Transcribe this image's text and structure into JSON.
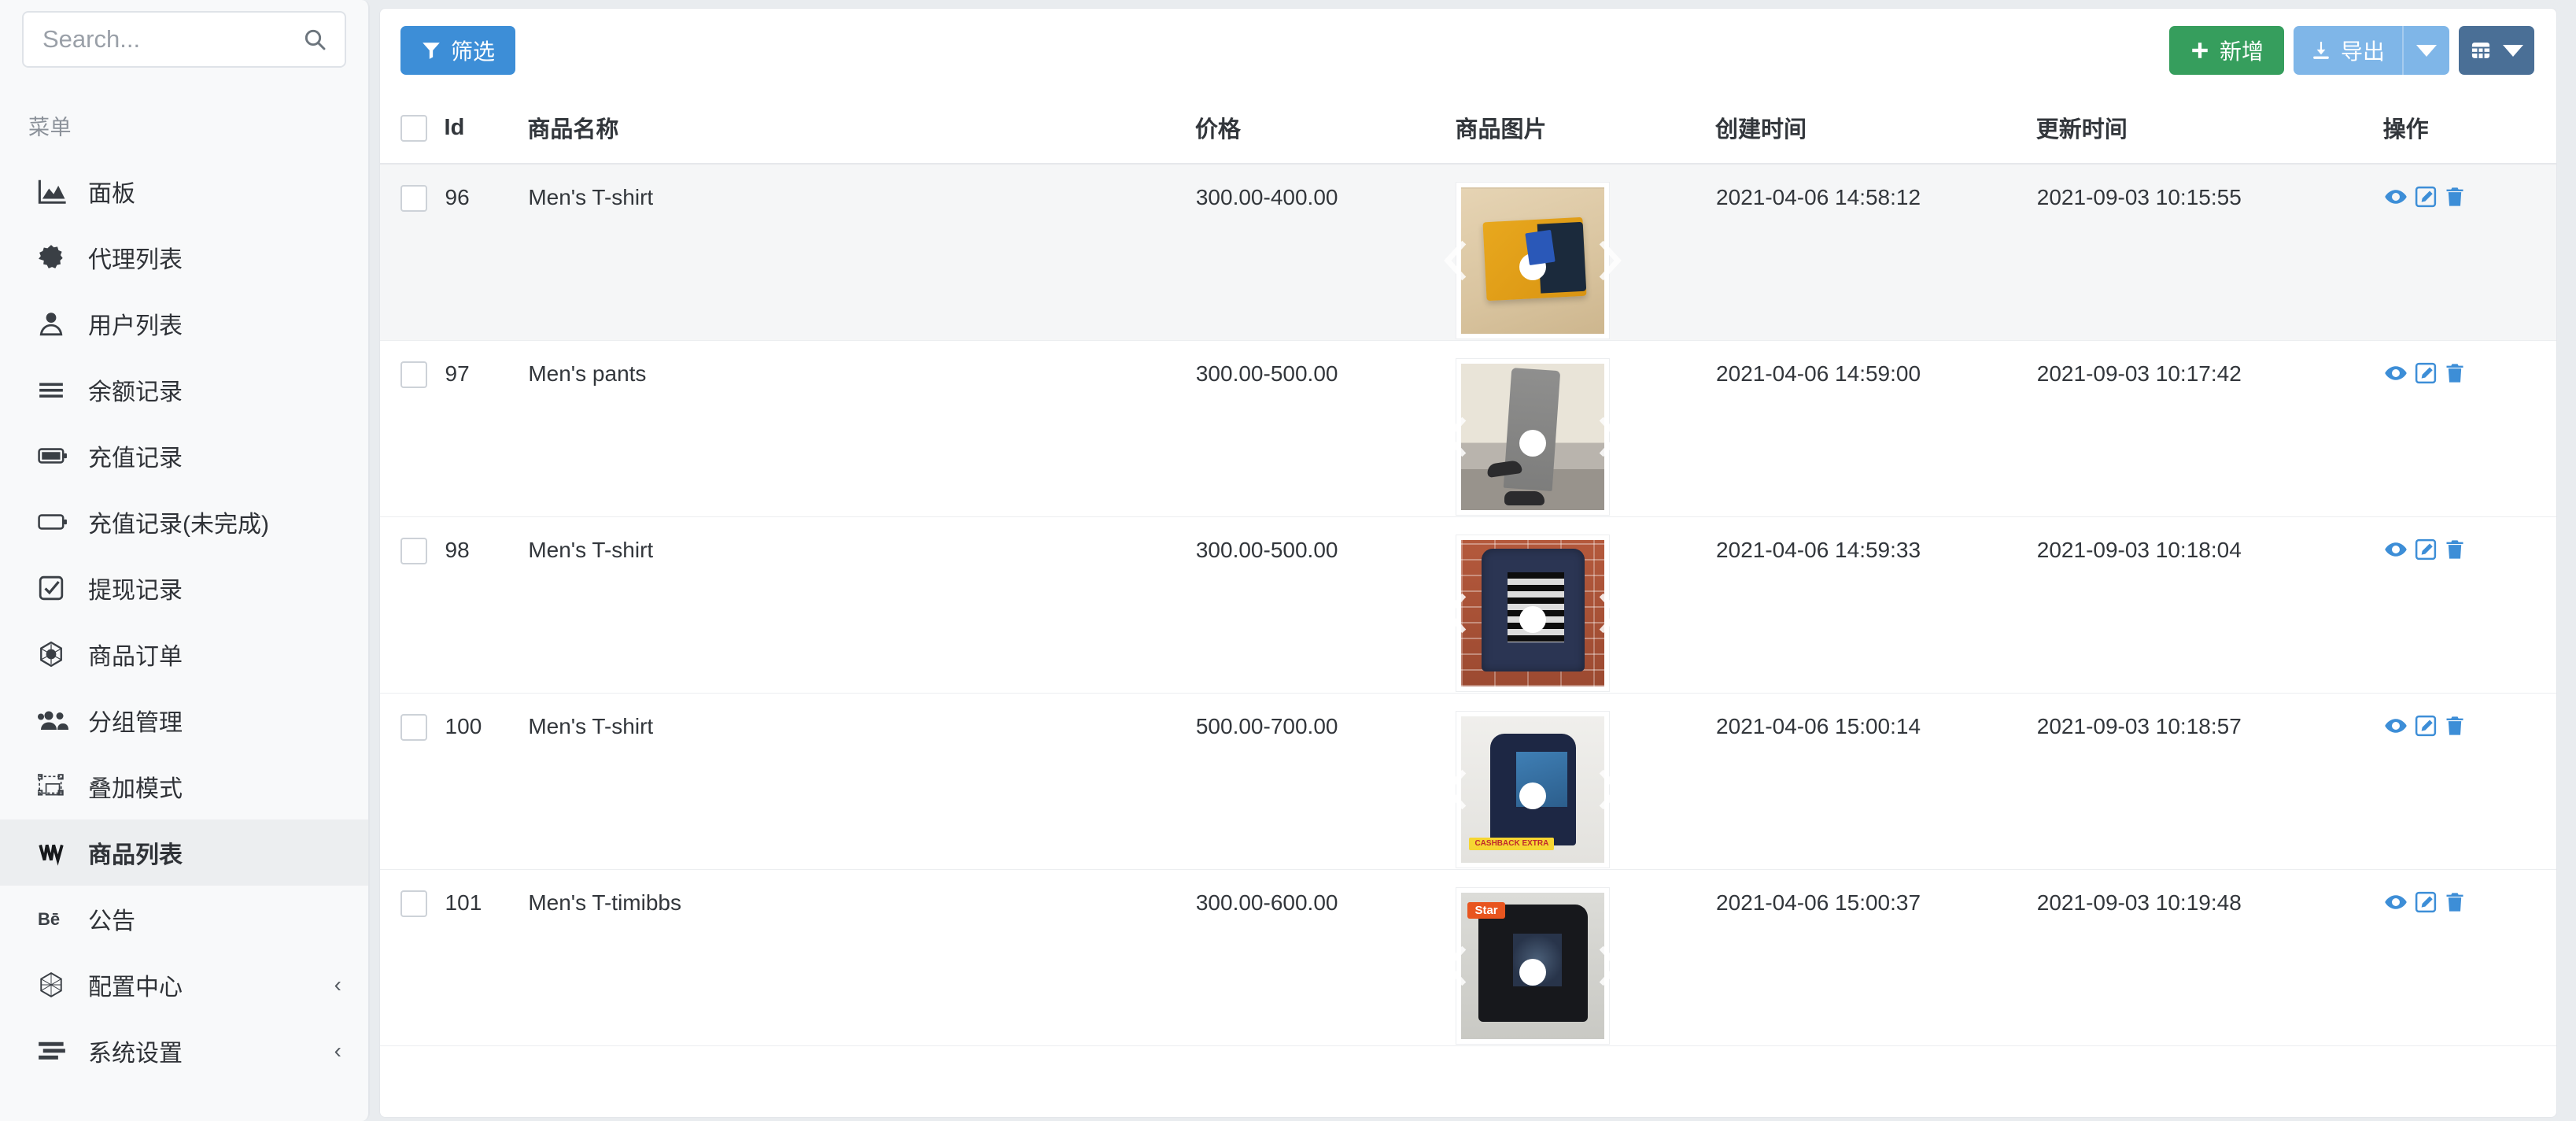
{
  "sidebar": {
    "search": {
      "value": "",
      "placeholder": "Search...",
      "icon": "search-icon"
    },
    "section_label": "菜单",
    "items": [
      {
        "label": "面板",
        "icon": "chart-area-icon",
        "active": false,
        "chevron": ""
      },
      {
        "label": "代理列表",
        "icon": "certificate-icon",
        "active": false,
        "chevron": ""
      },
      {
        "label": "用户列表",
        "icon": "user-circle-icon",
        "active": false,
        "chevron": ""
      },
      {
        "label": "余额记录",
        "icon": "bars-icon",
        "active": false,
        "chevron": ""
      },
      {
        "label": "充值记录",
        "icon": "battery-full-icon",
        "active": false,
        "chevron": ""
      },
      {
        "label": "充值记录(未完成)",
        "icon": "battery-empty-icon",
        "active": false,
        "chevron": ""
      },
      {
        "label": "提现记录",
        "icon": "check-square-icon",
        "active": false,
        "chevron": ""
      },
      {
        "label": "商品订单",
        "icon": "first-order-icon",
        "active": false,
        "chevron": ""
      },
      {
        "label": "分组管理",
        "icon": "users-icon",
        "active": false,
        "chevron": ""
      },
      {
        "label": "叠加模式",
        "icon": "object-group-icon",
        "active": false,
        "chevron": ""
      },
      {
        "label": "商品列表",
        "icon": "wpforms-icon",
        "active": true,
        "chevron": ""
      },
      {
        "label": "公告",
        "icon": "behance-icon",
        "active": false,
        "chevron": ""
      },
      {
        "label": "配置中心",
        "icon": "hexagon-icon",
        "active": false,
        "chevron": "‹"
      },
      {
        "label": "系统设置",
        "icon": "sliders-icon",
        "active": false,
        "chevron": "‹"
      }
    ]
  },
  "toolbar": {
    "filter_label": "筛选",
    "filter_icon": "funnel-icon",
    "add_label": "新增",
    "add_icon": "plus-icon",
    "export_label": "导出",
    "export_icon": "download-icon",
    "export_caret_icon": "caret-down-icon",
    "grid_icon": "table-grid-icon",
    "grid_caret_icon": "caret-down-icon",
    "colors": {
      "filter": "#3d8ed7",
      "add": "#369e5d",
      "export": "#7fb6e8",
      "grid": "#4a6f96",
      "action_icon": "#3d8ed7"
    }
  },
  "table": {
    "columns": [
      "",
      "Id",
      "商品名称",
      "价格",
      "商品图片",
      "创建时间",
      "更新时间",
      "操作"
    ],
    "action_icons": [
      "eye-icon",
      "edit-icon",
      "trash-icon"
    ],
    "rows": [
      {
        "id": "96",
        "name": "Men's T-shirt",
        "price": "300.00-400.00",
        "created": "2021-04-06 14:58:12",
        "updated": "2021-09-03 10:15:55",
        "image": "folded-yellow-tshirt-on-wood",
        "badge": ""
      },
      {
        "id": "97",
        "name": "Men's pants",
        "price": "300.00-500.00",
        "created": "2021-04-06 14:59:00",
        "updated": "2021-09-03 10:17:42",
        "image": "grey-pants-on-steps",
        "badge": ""
      },
      {
        "id": "98",
        "name": "Men's T-shirt",
        "price": "300.00-500.00",
        "created": "2021-04-06 14:59:33",
        "updated": "2021-09-03 10:18:04",
        "image": "navy-tshirt-on-brick-wall",
        "badge": ""
      },
      {
        "id": "100",
        "name": "Men's T-shirt",
        "price": "500.00-700.00",
        "created": "2021-04-06 15:00:14",
        "updated": "2021-09-03 10:18:57",
        "image": "navy-graphic-tee-on-mannequin",
        "badge": "CASHBACK EXTRA"
      },
      {
        "id": "101",
        "name": "Men's T-timibbs",
        "price": "300.00-600.00",
        "created": "2021-04-06 15:00:37",
        "updated": "2021-09-03 10:19:48",
        "image": "black-graphic-tee",
        "badge": "Star"
      }
    ]
  }
}
